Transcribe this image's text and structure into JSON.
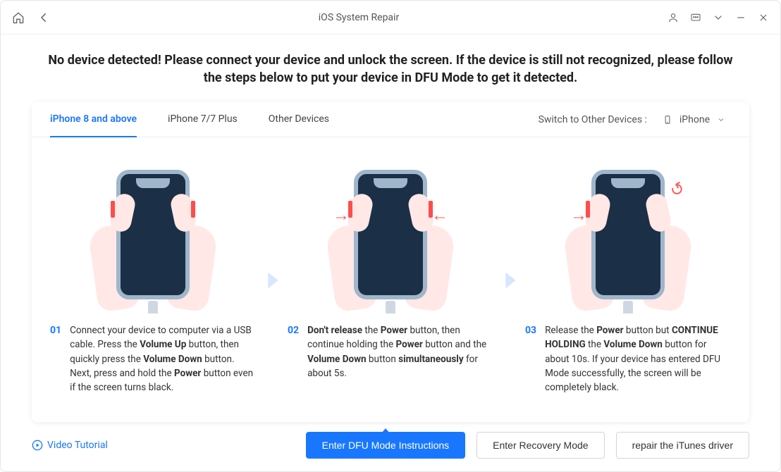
{
  "window_title": "iOS System Repair",
  "heading": "No device detected! Please connect your device and unlock the screen. If the device is still not recognized, please follow the steps below to put your device in DFU Mode to get it detected.",
  "tabs": {
    "t0": "iPhone 8 and above",
    "t1": "iPhone 7/7 Plus",
    "t2": "Other Devices"
  },
  "switch_label": "Switch to Other Devices :",
  "device_selected": "iPhone",
  "steps": {
    "s1_num": "01",
    "s1_html": "Connect your device to computer via a USB cable. Press the <b>Volume Up</b> button, then quickly press the <b>Volume Down</b> button. Next, press and hold the <b>Power</b> button even if the screen turns black.",
    "s2_num": "02",
    "s2_html": "<b>Don't release</b> the <b>Power</b> button, then continue holding the <b>Power</b> button and the <b>Volume Down</b> button <b>simultaneously</b> for about 5s.",
    "s3_num": "03",
    "s3_html": "Release the <b>Power</b> button but <b>CONTINUE HOLDING</b> the <b>Volume Down</b> button for about 10s. If your device has entered DFU Mode successfully, the screen will be completely black."
  },
  "footer": {
    "video": "Video Tutorial",
    "btn_primary": "Enter DFU Mode Instructions",
    "btn_recovery": "Enter Recovery Mode",
    "btn_repair": "repair the iTunes driver"
  }
}
